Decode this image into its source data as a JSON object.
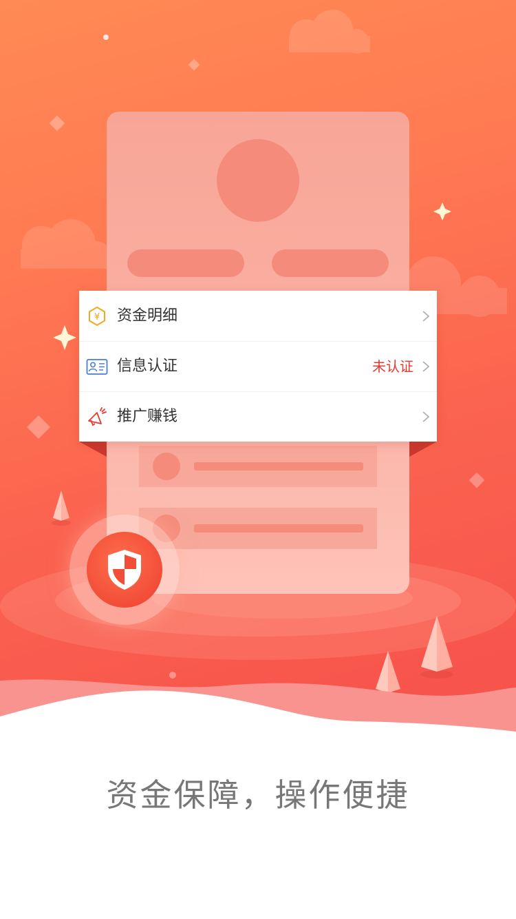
{
  "menu": {
    "items": [
      {
        "label": "资金明细",
        "status": "",
        "icon": "yuan-hexagon-icon"
      },
      {
        "label": "信息认证",
        "status": "未认证",
        "icon": "id-card-icon"
      },
      {
        "label": "推广赚钱",
        "status": "",
        "icon": "megaphone-icon"
      }
    ]
  },
  "slogan": "资金保障，操作便捷",
  "colors": {
    "accent": "#f6504a",
    "hero_top": "#ff8a55",
    "status_red": "#e8382f",
    "icon_orange": "#f5a623",
    "icon_blue": "#4a7bd8",
    "icon_red": "#e8382f"
  }
}
